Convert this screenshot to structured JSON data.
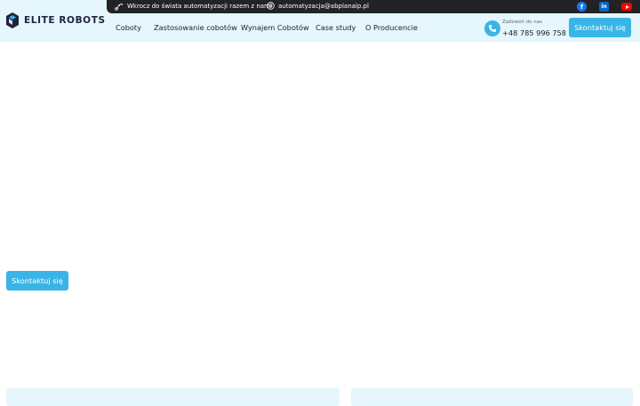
{
  "brand": {
    "name": "ELITE ROBOTS"
  },
  "topbar": {
    "tagline": "Wkrocz do świata automatyzacji razem z nami",
    "email": "automatyzacja@abplanalp.pl",
    "social": [
      "facebook-icon",
      "linkedin-icon",
      "youtube-icon"
    ]
  },
  "nav": {
    "items": [
      "Coboty",
      "Zastosowanie cobotów",
      "Wynajem Cobotów",
      "Case study",
      "O Producencie"
    ]
  },
  "contact": {
    "label": "Zadzwoń do nas",
    "phone": "+48 785 996 758",
    "button": "Skontaktuj się"
  },
  "hero": {
    "button": "Skontaktuj się"
  },
  "colors": {
    "accent": "#3ab4e6",
    "header_bg": "#e5f6fd",
    "topbar_bg": "#232326",
    "brand_dark": "#1e2340"
  }
}
